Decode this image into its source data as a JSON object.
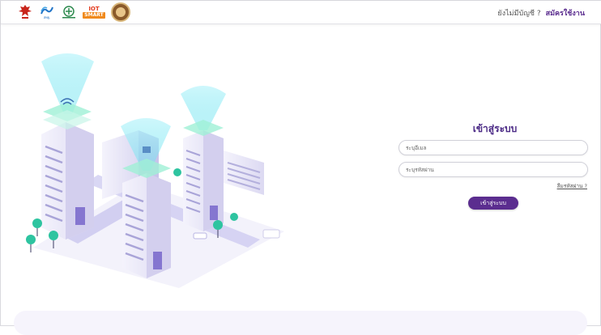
{
  "header": {
    "logos": [
      {
        "name": "thai-garuda-logo"
      },
      {
        "name": "ministry-logo",
        "caption": "สพฐ."
      },
      {
        "name": "health-logo"
      },
      {
        "name": "iot-logo",
        "line1": "IOT",
        "line2": "SMART"
      },
      {
        "name": "city-seal-logo"
      }
    ],
    "no_account_text": "ยังไม่มีบัญชี ?",
    "register_label": "สมัครใช้งาน"
  },
  "login": {
    "title": "เข้าสู่ระบบ",
    "email_placeholder": "ระบุอีเมล",
    "password_placeholder": "ระบุรหัสผ่าน",
    "forgot_label": "ลืมรหัสผ่าน ?",
    "submit_label": "เข้าสู่ระบบ"
  },
  "colors": {
    "brand_purple": "#5b2d8f",
    "title_purple": "#4b2a86",
    "beam_cyan": "#7fe6f2",
    "tree_green": "#2ec4a0"
  }
}
